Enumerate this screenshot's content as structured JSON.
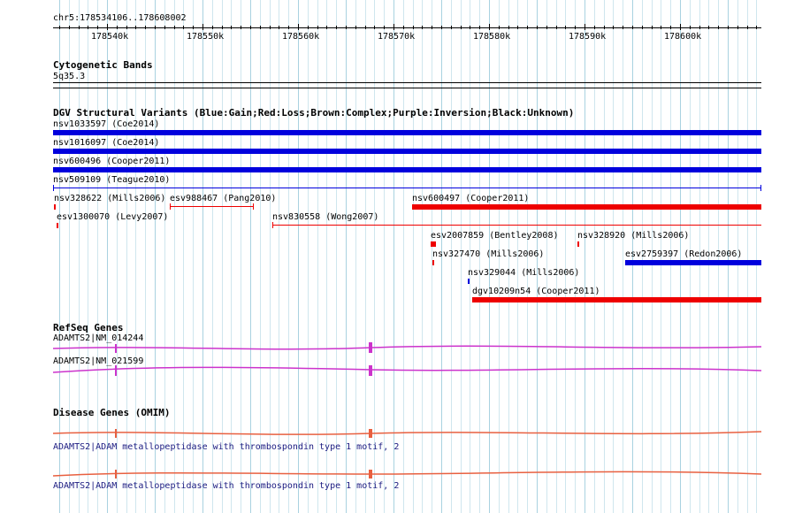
{
  "ruler": {
    "position": "chr5:178534106..178608002",
    "ticks": [
      "178540k",
      "178550k",
      "178560k",
      "178570k",
      "178580k",
      "178590k",
      "178600k"
    ]
  },
  "cytobands": {
    "title": "Cytogenetic Bands",
    "band": "5q35.3"
  },
  "dgv": {
    "title": "DGV Structural Variants (Blue:Gain;Red:Loss;Brown:Complex;Purple:Inversion;Black:Unknown)",
    "variants": [
      {
        "label": "nsv1033597 (Coe2014)",
        "color": "#0000dd"
      },
      {
        "label": "nsv1016097 (Coe2014)",
        "color": "#0000dd"
      },
      {
        "label": "nsv600496 (Cooper2011)",
        "color": "#0000dd"
      },
      {
        "label": "nsv509109 (Teague2010)",
        "color": "#0000dd"
      },
      {
        "label": "nsv328622 (Mills2006)",
        "color": "#ee0000"
      },
      {
        "label": "esv988467 (Pang2010)",
        "color": "#ee0000"
      },
      {
        "label": "nsv600497 (Cooper2011)",
        "color": "#ee0000"
      },
      {
        "label": "esv1300070 (Levy2007)",
        "color": "#ee0000"
      },
      {
        "label": "nsv830558 (Wong2007)",
        "color": "#ee0000"
      },
      {
        "label": "esv2007859 (Bentley2008)",
        "color": "#ee0000"
      },
      {
        "label": "nsv328920 (Mills2006)",
        "color": "#ee0000"
      },
      {
        "label": "nsv327470 (Mills2006)",
        "color": "#ee0000"
      },
      {
        "label": "esv2759397 (Redon2006)",
        "color": "#0000dd"
      },
      {
        "label": "nsv329044 (Mills2006)",
        "color": "#0000dd"
      },
      {
        "label": "dgv10209n54 (Cooper2011)",
        "color": "#ee0000"
      }
    ]
  },
  "refseq": {
    "title": "RefSeq Genes",
    "genes": [
      {
        "label": "ADAMTS2|NM_014244",
        "color": "#cc33cc"
      },
      {
        "label": "ADAMTS2|NM_021599",
        "color": "#cc33cc"
      }
    ]
  },
  "omim": {
    "title": "Disease Genes (OMIM)",
    "genes": [
      {
        "label": "ADAMTS2|ADAM metallopeptidase with thrombospondin type 1 motif, 2",
        "color": "#e86040"
      },
      {
        "label": "ADAMTS2|ADAM metallopeptidase with thrombospondin type 1 motif, 2",
        "color": "#e86040"
      }
    ]
  },
  "colors": {
    "gain": "#0000dd",
    "loss": "#ee0000",
    "gene": "#cc33cc",
    "omim": "#e86040",
    "gridline": "#cfe6ee"
  }
}
